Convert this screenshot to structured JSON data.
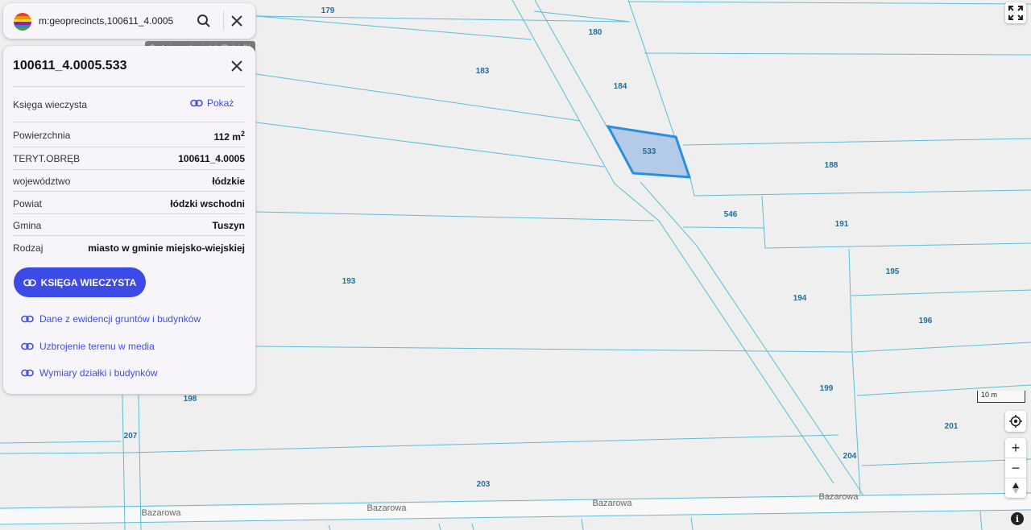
{
  "search": {
    "query": "m:geoprecincts,100611_4.0005",
    "tooltip": "Szukaj po adresie lub ID działki"
  },
  "panel": {
    "title": "100611_4.0005.533",
    "land_registry_label": "Księga wieczysta",
    "show_label": "Pokaż",
    "area_label": "Powierzchnia",
    "area_value": "112 m",
    "area_unit_sup": "2",
    "rows": [
      {
        "label": "TERYT.OBRĘB",
        "value": "100611_4.0005"
      },
      {
        "label": "województwo",
        "value": "łódzkie"
      },
      {
        "label": "Powiat",
        "value": "łódzki wschodni"
      },
      {
        "label": "Gmina",
        "value": "Tuszyn"
      },
      {
        "label": "Rodzaj",
        "value": "miasto w gminie miejsko-wiejskiej"
      }
    ],
    "button_label": "KSIĘGA WIECZYSTA",
    "links": [
      "Dane z ewidencji gruntów i budynków",
      "Uzbrojenie terenu w media",
      "Wymiary działki i budynków"
    ]
  },
  "map": {
    "parcels": [
      "179",
      "180",
      "183",
      "184",
      "533",
      "188",
      "546",
      "191",
      "195",
      "193",
      "194",
      "196",
      "199",
      "198",
      "201",
      "207",
      "204",
      "203"
    ],
    "selected_parcel": "533",
    "roads": [
      "Bazarowa",
      "Bazarowa",
      "Bazarowa",
      "Bazarowa"
    ],
    "scale_label": "10 m",
    "colors": {
      "parcel_line": "#5bbcd8",
      "selected_fill": "#b3cbe8",
      "selected_stroke": "#2a8ee0",
      "label": "#1f6f9a",
      "accent": "#3d4be6"
    }
  },
  "controls": {
    "fullscreen": "fullscreen-icon",
    "locate": "locate-icon",
    "zoom_in": "+",
    "zoom_out": "−",
    "compass": "compass-icon",
    "info": "i"
  }
}
